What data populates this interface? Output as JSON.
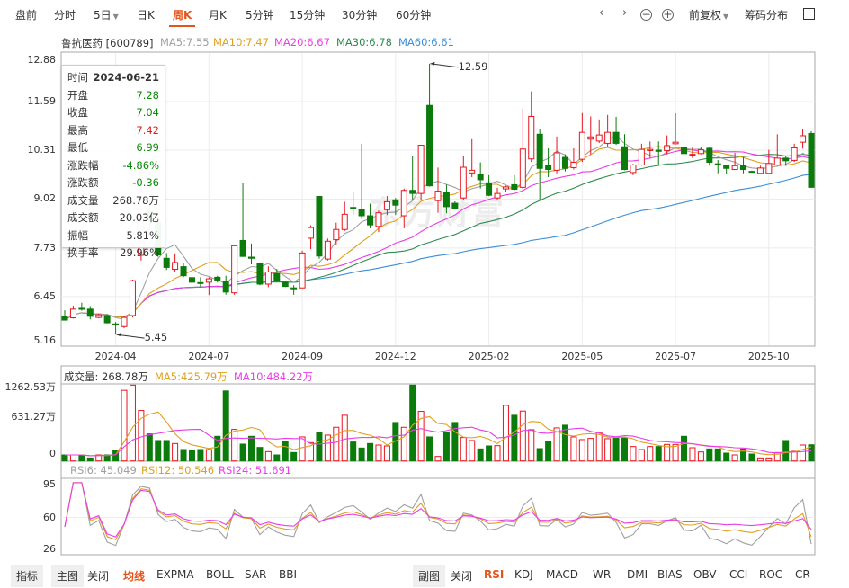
{
  "toolbar": {
    "periods": [
      "盘前",
      "分时",
      "5日",
      "日K",
      "周K",
      "月K",
      "5分钟",
      "15分钟",
      "30分钟",
      "60分钟"
    ],
    "active": "周K",
    "adjust": "前复权",
    "chips": "筹码分布"
  },
  "stock": {
    "name": "鲁抗医药 [600789]",
    "ma5": "MA5:7.55",
    "ma10": "MA10:7.47",
    "ma20": "MA20:6.67",
    "ma30": "MA30:6.78",
    "ma60": "MA60:6.61"
  },
  "watermark": "东方财富",
  "colors": {
    "up": "#e8141e",
    "down": "#0b7b0b",
    "ma5": "#a0a0a0",
    "ma10": "#e0a020",
    "ma20": "#e83ee8",
    "ma30": "#2e8b4e",
    "ma60": "#3a8fd8",
    "accent": "#e5541b"
  },
  "price_axis": [
    "12.88",
    "11.59",
    "10.31",
    "9.02",
    "7.73",
    "6.45",
    "5.16"
  ],
  "xticks": [
    {
      "label": "2024-04",
      "index": 6
    },
    {
      "label": "2024-07",
      "index": 17
    },
    {
      "label": "2024-09",
      "index": 28
    },
    {
      "label": "2024-12",
      "index": 39
    },
    {
      "label": "2025-02",
      "index": 50
    },
    {
      "label": "2025-05",
      "index": 61
    },
    {
      "label": "2025-07",
      "index": 72
    },
    {
      "label": "2025-10",
      "index": 83
    }
  ],
  "max_label": "12.59",
  "min_label": "5.45",
  "tooltip": {
    "rows": [
      {
        "k": "时间",
        "v": "2024-06-21",
        "c": ""
      },
      {
        "k": "开盘",
        "v": "7.28",
        "c": "g"
      },
      {
        "k": "收盘",
        "v": "7.04",
        "c": "g"
      },
      {
        "k": "最高",
        "v": "7.42",
        "c": "r"
      },
      {
        "k": "最低",
        "v": "6.99",
        "c": "g"
      },
      {
        "k": "涨跌幅",
        "v": "-4.86%",
        "c": "g"
      },
      {
        "k": "涨跌额",
        "v": "-0.36",
        "c": "g"
      },
      {
        "k": "成交量",
        "v": "268.78万",
        "c": ""
      },
      {
        "k": "成交额",
        "v": "20.03亿",
        "c": ""
      },
      {
        "k": "振幅",
        "v": "5.81%",
        "c": ""
      },
      {
        "k": "换手率",
        "v": "29.96%",
        "c": ""
      }
    ]
  },
  "volume": {
    "label": "成交量: 268.78万",
    "ma5": "MA5:425.79万",
    "ma10": "MA10:484.22万",
    "axis": [
      "1262.53万",
      "631.27万",
      "0"
    ]
  },
  "rsi": {
    "rsi6": "RSI6: 45.049",
    "rsi12": "RSI12: 50.546",
    "rsi24": "RSI24: 51.691",
    "axis": [
      "95",
      "60",
      "26"
    ]
  },
  "bottom": {
    "left": [
      "指标",
      "主图",
      "关闭",
      "均线",
      "EXPMA",
      "BOLL",
      "SAR",
      "BBI"
    ],
    "right": [
      "副图",
      "关闭",
      "RSI",
      "KDJ",
      "MACD",
      "WR",
      "DMI",
      "BIAS",
      "OBV",
      "CCI",
      "ROC",
      "CR"
    ]
  },
  "chart_data": {
    "type": "candlestick",
    "ohlc": [
      [
        5.93,
        5.83,
        6.09,
        5.82
      ],
      [
        5.89,
        6.12,
        6.21,
        5.87
      ],
      [
        6.14,
        6.12,
        6.29,
        6.08
      ],
      [
        6.12,
        5.93,
        6.2,
        5.85
      ],
      [
        5.9,
        5.97,
        6.0,
        5.88
      ],
      [
        5.95,
        5.76,
        5.98,
        5.74
      ],
      [
        5.73,
        5.71,
        5.78,
        5.45
      ],
      [
        5.66,
        5.9,
        5.93,
        5.62
      ],
      [
        5.95,
        6.87,
        6.9,
        5.9
      ],
      [
        7.54,
        8.5,
        8.8,
        7.4
      ],
      [
        8.7,
        8.45,
        9.0,
        8.2
      ],
      [
        8.41,
        7.55,
        8.6,
        7.5
      ],
      [
        7.46,
        7.22,
        7.6,
        7.15
      ],
      [
        7.17,
        7.35,
        7.59,
        7.09
      ],
      [
        7.24,
        7.0,
        7.35,
        6.96
      ],
      [
        6.95,
        6.83,
        6.98,
        6.78
      ],
      [
        6.82,
        6.8,
        6.96,
        6.7
      ],
      [
        6.83,
        6.92,
        6.96,
        6.49
      ],
      [
        6.96,
        6.88,
        7.0,
        6.82
      ],
      [
        6.84,
        6.57,
        7.0,
        6.5
      ],
      [
        6.55,
        7.79,
        7.8,
        6.5
      ],
      [
        7.93,
        7.51,
        9.45,
        7.5
      ],
      [
        7.49,
        7.46,
        7.85,
        7.3
      ],
      [
        7.32,
        6.78,
        7.35,
        6.75
      ],
      [
        6.78,
        7.1,
        7.25,
        6.7
      ],
      [
        7.06,
        6.86,
        7.18,
        6.84
      ],
      [
        6.83,
        6.72,
        6.86,
        6.7
      ],
      [
        6.68,
        6.66,
        6.75,
        6.5
      ],
      [
        6.68,
        7.6,
        7.66,
        6.67
      ],
      [
        7.99,
        8.27,
        8.33,
        7.7
      ],
      [
        9.09,
        7.52,
        9.09,
        7.45
      ],
      [
        7.44,
        7.91,
        7.98,
        7.4
      ],
      [
        7.95,
        8.22,
        8.4,
        7.82
      ],
      [
        8.22,
        8.62,
        8.95,
        8.18
      ],
      [
        8.8,
        8.78,
        9.2,
        8.6
      ],
      [
        8.74,
        8.58,
        10.48,
        8.5
      ],
      [
        8.58,
        8.34,
        8.9,
        8.25
      ],
      [
        8.3,
        8.66,
        8.72,
        8.15
      ],
      [
        8.74,
        8.95,
        9.1,
        8.6
      ],
      [
        9.0,
        8.86,
        9.05,
        8.6
      ],
      [
        8.58,
        9.25,
        9.3,
        8.25
      ],
      [
        9.25,
        9.17,
        10.16,
        9.0
      ],
      [
        9.17,
        10.44,
        10.44,
        9.0
      ],
      [
        11.49,
        9.37,
        12.59,
        9.35
      ],
      [
        8.98,
        9.23,
        9.85,
        8.66
      ],
      [
        9.2,
        8.82,
        9.4,
        8.65
      ],
      [
        8.91,
        8.78,
        8.96,
        8.75
      ],
      [
        9.05,
        9.86,
        10.16,
        9.0
      ],
      [
        9.71,
        9.78,
        10.6,
        9.6
      ],
      [
        9.67,
        9.53,
        9.99,
        9.3
      ],
      [
        9.45,
        9.12,
        9.65,
        9.1
      ],
      [
        9.05,
        9.17,
        9.32,
        9.0
      ],
      [
        9.29,
        9.34,
        9.37,
        9.2
      ],
      [
        9.4,
        9.28,
        9.65,
        9.25
      ],
      [
        9.33,
        10.34,
        11.4,
        9.25
      ],
      [
        10.08,
        11.2,
        11.86,
        10.0
      ],
      [
        10.73,
        9.83,
        10.87,
        8.99
      ],
      [
        9.92,
        9.8,
        10.36,
        9.6
      ],
      [
        9.78,
        10.24,
        10.67,
        9.7
      ],
      [
        10.12,
        9.83,
        10.2,
        9.75
      ],
      [
        9.85,
        9.99,
        10.36,
        9.8
      ],
      [
        10.07,
        10.78,
        11.29,
        10.0
      ],
      [
        10.6,
        10.66,
        11.2,
        10.2
      ],
      [
        10.55,
        10.71,
        11.12,
        10.5
      ],
      [
        10.49,
        10.78,
        11.24,
        10.4
      ],
      [
        10.78,
        10.49,
        11.19,
        10.45
      ],
      [
        10.4,
        9.8,
        10.73,
        9.78
      ],
      [
        9.72,
        9.92,
        9.95,
        9.65
      ],
      [
        9.92,
        10.33,
        10.48,
        9.9
      ],
      [
        10.3,
        10.33,
        10.54,
        10.1
      ],
      [
        10.31,
        10.28,
        10.54,
        9.92
      ],
      [
        10.3,
        10.43,
        10.7,
        10.2
      ],
      [
        10.48,
        10.52,
        11.28,
        10.46
      ],
      [
        10.38,
        10.22,
        10.55,
        10.18
      ],
      [
        10.18,
        10.2,
        10.4,
        10.1
      ],
      [
        10.22,
        10.32,
        10.4,
        10.2
      ],
      [
        10.36,
        9.99,
        10.4,
        9.9
      ],
      [
        9.95,
        9.94,
        10.05,
        9.7
      ],
      [
        9.9,
        9.83,
        9.93,
        9.69
      ],
      [
        9.8,
        9.9,
        10.24,
        9.8
      ],
      [
        9.9,
        9.8,
        10.12,
        9.7
      ],
      [
        9.75,
        9.74,
        9.77,
        9.72
      ],
      [
        9.7,
        9.84,
        9.9,
        9.68
      ],
      [
        9.7,
        9.96,
        10.32,
        9.7
      ],
      [
        9.92,
        10.1,
        10.73,
        9.9
      ],
      [
        10.1,
        10.03,
        10.17,
        9.9
      ],
      [
        10.04,
        10.37,
        10.48,
        10.0
      ],
      [
        10.52,
        10.69,
        10.87,
        10.35
      ],
      [
        10.75,
        9.33,
        10.81,
        9.33
      ]
    ],
    "volume": [
      100,
      100,
      100,
      50,
      100,
      100,
      170,
      1175,
      1262,
      840,
      450,
      340,
      340,
      290,
      190,
      180,
      190,
      190,
      410,
      1165,
      525,
      280,
      410,
      225,
      155,
      100,
      320,
      140,
      400,
      305,
      475,
      430,
      560,
      760,
      315,
      215,
      290,
      265,
      250,
      640,
      560,
      1262,
      825,
      400,
      75,
      475,
      640,
      390,
      340,
      200,
      250,
      255,
      925,
      760,
      830,
      520,
      205,
      325,
      550,
      595,
      400,
      355,
      375,
      475,
      370,
      380,
      385,
      240,
      190,
      240,
      240,
      275,
      275,
      410,
      220,
      150,
      200,
      200,
      130,
      100,
      200,
      115,
      50,
      50,
      140,
      340,
      160,
      265,
      269
    ],
    "price_range": [
      5.16,
      12.88
    ],
    "volume_range": [
      0,
      1262.53
    ],
    "rsi_range": [
      26,
      95
    ]
  }
}
